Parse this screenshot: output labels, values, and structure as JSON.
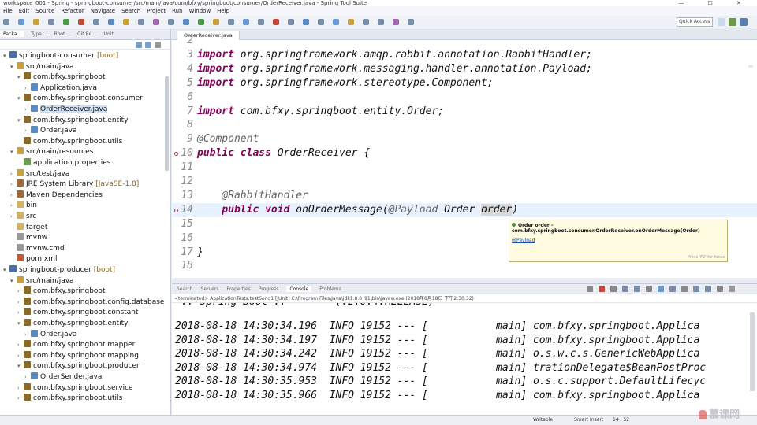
{
  "window": {
    "title": "workspace_001 - Spring - springboot-consumer/src/main/java/com/bfxy/springboot/consumer/OrderReceiver.java - Spring Tool Suite"
  },
  "menu": [
    "File",
    "Edit",
    "Source",
    "Refactor",
    "Navigate",
    "Search",
    "Project",
    "Run",
    "Window",
    "Help"
  ],
  "toolbar": {
    "quick_access": "Quick Access"
  },
  "explorer": {
    "tabs": [
      "Packa...",
      "Type ...",
      "Boot ...",
      "Git Re...",
      "JUnit"
    ],
    "items": [
      {
        "label": "springboot-consumer",
        "deco": " [boot]",
        "twisty": "▾",
        "icon": "project-icon"
      },
      {
        "label": "src/main/java",
        "deco": "",
        "twisty": "▾",
        "icon": "source-folder-icon"
      },
      {
        "label": "com.bfxy.springboot",
        "deco": "",
        "twisty": "▾",
        "icon": "package-icon"
      },
      {
        "label": "Application.java",
        "deco": "",
        "twisty": "›",
        "icon": "java-file-icon"
      },
      {
        "label": "com.bfxy.springboot.consumer",
        "deco": "",
        "twisty": "▾",
        "icon": "package-icon"
      },
      {
        "label": "OrderReceiver.java",
        "deco": "",
        "twisty": "›",
        "icon": "java-file-icon"
      },
      {
        "label": "com.bfxy.springboot.entity",
        "deco": "",
        "twisty": "▾",
        "icon": "package-icon"
      },
      {
        "label": "Order.java",
        "deco": "",
        "twisty": "›",
        "icon": "java-file-icon"
      },
      {
        "label": "com.bfxy.springboot.utils",
        "deco": "",
        "twisty": "",
        "icon": "package-icon"
      },
      {
        "label": "src/main/resources",
        "deco": "",
        "twisty": "▾",
        "icon": "source-folder-icon"
      },
      {
        "label": "application.properties",
        "deco": "",
        "twisty": "",
        "icon": "properties-file-icon"
      },
      {
        "label": "src/test/java",
        "deco": "",
        "twisty": "›",
        "icon": "source-folder-icon"
      },
      {
        "label": "JRE System Library",
        "deco": " [JavaSE-1.8]",
        "twisty": "›",
        "icon": "library-icon"
      },
      {
        "label": "Maven Dependencies",
        "deco": "",
        "twisty": "›",
        "icon": "library-icon"
      },
      {
        "label": "bin",
        "deco": "",
        "twisty": "›",
        "icon": "folder-icon"
      },
      {
        "label": "src",
        "deco": "",
        "twisty": "›",
        "icon": "folder-icon"
      },
      {
        "label": "target",
        "deco": "",
        "twisty": "",
        "icon": "folder-icon"
      },
      {
        "label": "mvnw",
        "deco": "",
        "twisty": "",
        "icon": "file-icon"
      },
      {
        "label": "mvnw.cmd",
        "deco": "",
        "twisty": "",
        "icon": "file-icon"
      },
      {
        "label": "pom.xml",
        "deco": "",
        "twisty": "",
        "icon": "xml-file-icon"
      },
      {
        "label": "springboot-producer",
        "deco": " [boot]",
        "twisty": "▾",
        "icon": "project-icon"
      },
      {
        "label": "src/main/java",
        "deco": "",
        "twisty": "▾",
        "icon": "source-folder-icon"
      },
      {
        "label": "com.bfxy.springboot",
        "deco": "",
        "twisty": "›",
        "icon": "package-icon"
      },
      {
        "label": "com.bfxy.springboot.config.database",
        "deco": "",
        "twisty": "›",
        "icon": "package-icon"
      },
      {
        "label": "com.bfxy.springboot.constant",
        "deco": "",
        "twisty": "›",
        "icon": "package-icon"
      },
      {
        "label": "com.bfxy.springboot.entity",
        "deco": "",
        "twisty": "▾",
        "icon": "package-icon"
      },
      {
        "label": "Order.java",
        "deco": "",
        "twisty": "›",
        "icon": "java-file-icon"
      },
      {
        "label": "com.bfxy.springboot.mapper",
        "deco": "",
        "twisty": "›",
        "icon": "package-icon"
      },
      {
        "label": "com.bfxy.springboot.mapping",
        "deco": "",
        "twisty": "›",
        "icon": "package-icon"
      },
      {
        "label": "com.bfxy.springboot.producer",
        "deco": "",
        "twisty": "▾",
        "icon": "package-icon"
      },
      {
        "label": "OrderSender.java",
        "deco": "",
        "twisty": "›",
        "icon": "java-file-icon"
      },
      {
        "label": "com.bfxy.springboot.service",
        "deco": "",
        "twisty": "›",
        "icon": "package-icon"
      },
      {
        "label": "com.bfxy.springboot.utils",
        "deco": "",
        "twisty": "›",
        "icon": "package-icon"
      }
    ]
  },
  "editor": {
    "tab_label": "OrderReceiver.java",
    "lines": [
      {
        "num": "2",
        "tokens": []
      },
      {
        "num": "3",
        "tokens": [
          {
            "t": "import",
            "c": "kw"
          },
          {
            "t": " org.springframework.amqp.rabbit.annotation.RabbitHandler;",
            "c": ""
          }
        ]
      },
      {
        "num": "4",
        "tokens": [
          {
            "t": "import",
            "c": "kw"
          },
          {
            "t": " org.springframework.messaging.handler.annotation.Payload;",
            "c": ""
          }
        ]
      },
      {
        "num": "5",
        "tokens": [
          {
            "t": "import",
            "c": "kw"
          },
          {
            "t": " org.springframework.stereotype.Component;",
            "c": ""
          }
        ]
      },
      {
        "num": "6",
        "tokens": []
      },
      {
        "num": "7",
        "tokens": [
          {
            "t": "import",
            "c": "kw"
          },
          {
            "t": " com.bfxy.springboot.entity.Order;",
            "c": ""
          }
        ]
      },
      {
        "num": "8",
        "tokens": []
      },
      {
        "num": "9",
        "tokens": [
          {
            "t": "@Component",
            "c": "ann"
          }
        ]
      },
      {
        "num": "10",
        "tokens": [
          {
            "t": "public",
            "c": "kw"
          },
          {
            "t": " ",
            "c": ""
          },
          {
            "t": "class",
            "c": "kw"
          },
          {
            "t": " OrderReceiver {",
            "c": ""
          }
        ]
      },
      {
        "num": "11",
        "tokens": []
      },
      {
        "num": "12",
        "tokens": []
      },
      {
        "num": "13",
        "tokens": [
          {
            "t": "    ",
            "c": ""
          },
          {
            "t": "@RabbitHandler",
            "c": "ann"
          }
        ]
      },
      {
        "num": "14",
        "tokens": [
          {
            "t": "    ",
            "c": ""
          },
          {
            "t": "public",
            "c": "kw"
          },
          {
            "t": " ",
            "c": ""
          },
          {
            "t": "void",
            "c": "kw"
          },
          {
            "t": " onOrderMessage(",
            "c": ""
          },
          {
            "t": "@Payload",
            "c": "ann"
          },
          {
            "t": " Order ",
            "c": ""
          },
          {
            "t": "order",
            "c": "var-hl"
          },
          {
            "t": ")",
            "c": ""
          }
        ]
      },
      {
        "num": "15",
        "tokens": []
      },
      {
        "num": "16",
        "tokens": []
      },
      {
        "num": "17",
        "tokens": [
          {
            "t": "}",
            "c": ""
          }
        ]
      },
      {
        "num": "18",
        "tokens": []
      }
    ],
    "hover": {
      "signature": "Order order - com.bfxy.springboot.consumer.OrderReceiver.onOrderMessage(Order)",
      "link": "@Payload",
      "footer": "Press 'F2' for focus"
    }
  },
  "console": {
    "tabs": [
      "Search",
      "Servers",
      "Properties",
      "Progress",
      "Console",
      "Problems"
    ],
    "header": "<terminated> ApplicationTests.testSend1 [JUnit] C:\\Program Files\\Java\\jdk1.8.0_91\\bin\\javaw.exe (2018年8月18日 下午2:30:32)",
    "partial_line": " :: Spring Boot ::        (v2.0.4.RELEASE)",
    "lines": [
      "2018-08-18 14:30:34.196  INFO 19152 --- [           main] com.bfxy.springboot.Applica",
      "2018-08-18 14:30:34.197  INFO 19152 --- [           main] com.bfxy.springboot.Applica",
      "2018-08-18 14:30:34.242  INFO 19152 --- [           main] o.s.w.c.s.GenericWebApplica",
      "2018-08-18 14:30:34.974  INFO 19152 --- [           main] trationDelegate$BeanPostProc",
      "2018-08-18 14:30:35.953  INFO 19152 --- [           main] o.s.c.support.DefaultLifecyc",
      "2018-08-18 14:30:35.966  INFO 19152 --- [           main] com.bfxy.springboot.Applica"
    ]
  },
  "status": {
    "mode": "Writable",
    "insert": "Smart Insert",
    "position": "14 : 52"
  },
  "watermark": "慕课网"
}
